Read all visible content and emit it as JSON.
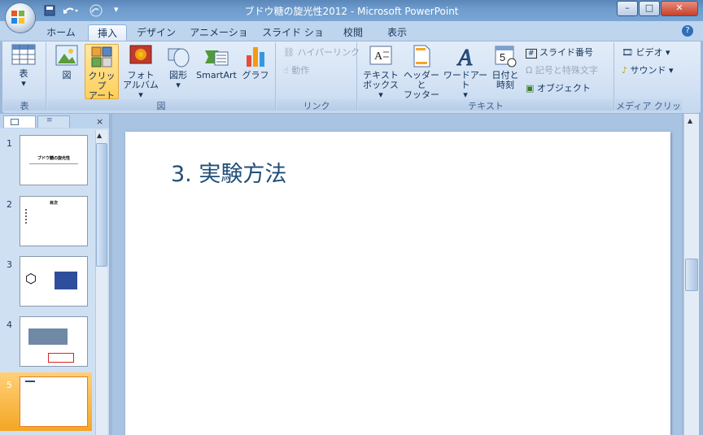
{
  "window": {
    "title": "ブドウ糖の旋光性2012 - Microsoft PowerPoint",
    "min": "–",
    "max": "□",
    "close": "✕"
  },
  "tabs": [
    "ホーム",
    "挿入",
    "デザイン",
    "アニメーション",
    "スライド ショー",
    "校閲",
    "表示"
  ],
  "active_tab": "挿入",
  "ribbon": {
    "table_label": "表",
    "groups": {
      "table": "表",
      "image": "図",
      "link": "リンク",
      "text": "テキスト",
      "media": "メディア クリップ"
    },
    "buttons": {
      "picture": "図",
      "clipart_l1": "クリップ",
      "clipart_l2": "アート",
      "photo_l1": "フォト",
      "photo_l2": "アルバム ▾",
      "shapes": "図形",
      "smartart": "SmartArt",
      "chart": "グラフ",
      "hyperlink": "ハイパーリンク",
      "action": "動作",
      "textbox_l1": "テキスト",
      "textbox_l2": "ボックス ▾",
      "header_l1": "ヘッダーと",
      "header_l2": "フッター",
      "wordart": "ワードアート",
      "wordart_arrow": "▾",
      "date_l1": "日付と",
      "date_l2": "時刻",
      "slide_number": "スライド番号",
      "symbol": "記号と特殊文字",
      "object": "オブジェクト",
      "video": "ビデオ ▾",
      "sound": "サウンド ▾"
    }
  },
  "slides_pane": {
    "close": "×",
    "thumbnails": [
      {
        "num": "1",
        "title": "ブドウ糖の旋光性"
      },
      {
        "num": "2",
        "title": "目次"
      },
      {
        "num": "3",
        "title": ""
      },
      {
        "num": "4",
        "title": ""
      },
      {
        "num": "5",
        "title": ""
      }
    ]
  },
  "slide": {
    "title": "3. 実験方法"
  },
  "colors": {
    "accent": "#1f4e79",
    "selected_thumb": "#f5a623"
  }
}
